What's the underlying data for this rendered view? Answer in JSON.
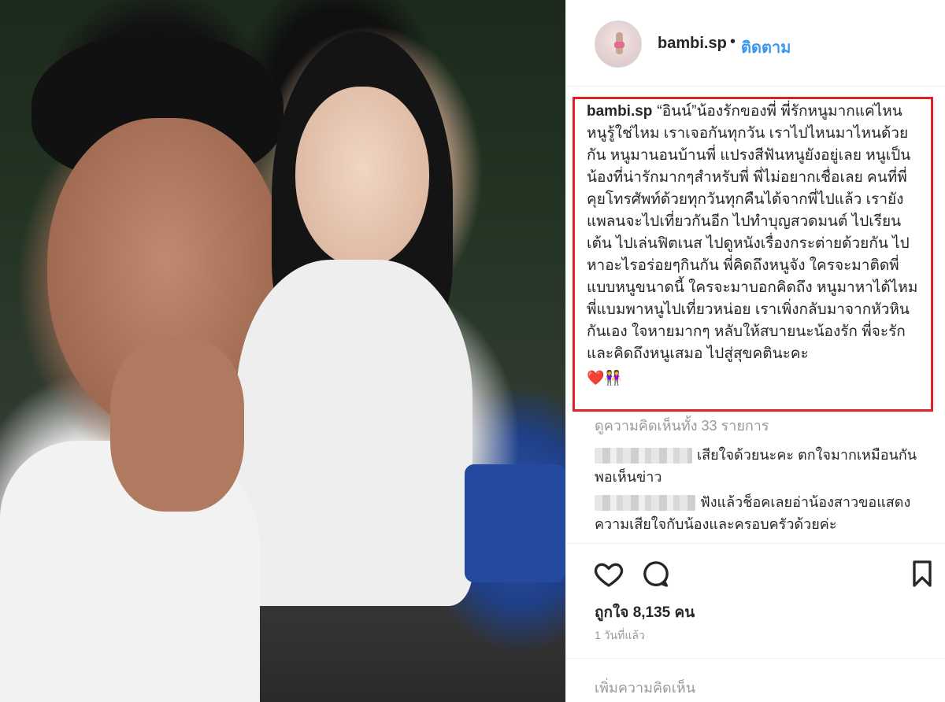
{
  "post": {
    "username": "bambi.sp",
    "separator": "•",
    "follow_label": "ติดตาม"
  },
  "caption": {
    "username": "bambi.sp",
    "text": "“อินน์”น้องรักของพี่ พี่รักหนูมากแค่ไหน หนูรู้ใช่ไหม เราเจอกันทุกวัน เราไปไหนมาไหนด้วยกัน หนูมานอนบ้านพี่ แปรงสีฟันหนูยังอยู่เลย หนูเป็นน้องที่น่ารักมากๆสำหรับพี่ พี่ไม่อยากเชื่อเลย คนที่พี่คุยโทรศัพท์ด้วยทุกวันทุกคืนได้จากพี่ไปแล้ว เรายังแพลนจะไปเที่ยวกันอีก ไปทำบุญสวดมนต์ ไปเรียนเต้น ไปเล่นฟิตเนส ไปดูหนังเรื่องกระต่ายด้วยกัน ไปหาอะไรอร่อยๆกินกัน พี่คิดถึงหนูจัง ใครจะมาติดพี่แบบหนูขนาดนี้ ใครจะมาบอกคิดถึง หนูมาหาได้ไหม พี่แบมพาหนูไปเที่ยวหน่อย เราเพิ่งกลับมาจากหัวหินกันเอง ใจหายมากๆ หลับให้สบายนะน้องรัก พี่จะรักและคิดถึงหนูเสมอ ไปสู่สุขคตินะคะ",
    "emoji": "❤️👭"
  },
  "comments": {
    "view_all": "ดูความคิดเห็นทั้ง 33 รายการ",
    "items": [
      {
        "text": "เสียใจด้วยนะคะ ตกใจมากเหมือนกัน พอเห็นข่าว"
      },
      {
        "text": "ฟังแล้วช็อคเลยอ่าน้องสาวขอแสดงความเสียใจกับน้องและครอบครัวด้วยค่ะ"
      }
    ]
  },
  "actions": {
    "like_icon": "heart-icon",
    "comment_icon": "comment-icon",
    "save_icon": "bookmark-icon"
  },
  "likes_text": "ถูกใจ 8,135 คน",
  "time_ago": "1 วันที่แล้ว",
  "add_comment_placeholder": "เพิ่มความคิดเห็น"
}
